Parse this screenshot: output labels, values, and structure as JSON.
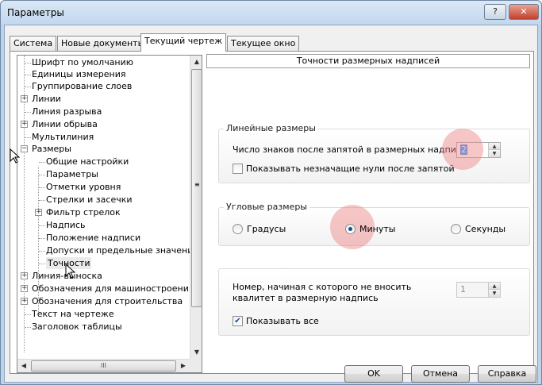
{
  "window": {
    "title": "Параметры",
    "help_glyph": "?",
    "close_glyph": "✕"
  },
  "tabs": [
    {
      "label": "Система",
      "active": false
    },
    {
      "label": "Новые документы",
      "active": false
    },
    {
      "label": "Текущий чертеж",
      "active": true
    },
    {
      "label": "Текущее окно",
      "active": false
    }
  ],
  "tree": {
    "items": [
      {
        "label": "Шрифт по умолчанию"
      },
      {
        "label": "Единицы измерения"
      },
      {
        "label": "Группирование слоев"
      },
      {
        "label": "Линии",
        "expander": "+"
      },
      {
        "label": "Линия разрыва"
      },
      {
        "label": "Линии обрыва",
        "expander": "+"
      },
      {
        "label": "Мультилиния"
      },
      {
        "label": "Размеры",
        "expander": "−"
      },
      {
        "label": "Общие настройки"
      },
      {
        "label": "Параметры"
      },
      {
        "label": "Отметки уровня"
      },
      {
        "label": "Стрелки и засечки"
      },
      {
        "label": "Фильтр стрелок",
        "expander": "+"
      },
      {
        "label": "Надпись"
      },
      {
        "label": "Положение надписи"
      },
      {
        "label": "Допуски и предельные значени"
      },
      {
        "label": "Точности",
        "selected": true
      },
      {
        "label": "Линия-выноска",
        "expander": "+"
      },
      {
        "label": "Обозначения для машиностроения",
        "expander": "+"
      },
      {
        "label": "Обозначения для строительства",
        "expander": "+"
      },
      {
        "label": "Текст на чертеже"
      },
      {
        "label": "Заголовок таблицы"
      }
    ],
    "hscroll_grip": "III",
    "scroll_up_glyph": "▲",
    "scroll_down_glyph": "▼",
    "scroll_left_glyph": "◀",
    "scroll_right_glyph": "▶",
    "vscroll_grip": "≡"
  },
  "section_title": "Точности размерных надписей",
  "linear": {
    "title": "Линейные размеры",
    "decimals_label": "Число знаков после запятой в размерных надписях",
    "decimals_value": "2",
    "show_zeros_label": "Показывать незначащие нули после запятой",
    "show_zeros_checked": false
  },
  "angular": {
    "title": "Угловые размеры",
    "options": [
      {
        "label": "Градусы",
        "selected": false
      },
      {
        "label": "Минуты",
        "selected": true
      },
      {
        "label": "Секунды",
        "selected": false
      }
    ]
  },
  "tolerance": {
    "label": "Номер, начиная с которого не вносить квалитет в размерную надпись",
    "value": "1",
    "show_all_label": "Показывать все",
    "show_all_checked": true
  },
  "buttons": {
    "ok": "OK",
    "cancel": "Отмена",
    "help": "Справка"
  },
  "spin_up_glyph": "▲",
  "spin_down_glyph": "▼",
  "check_glyph": "✔"
}
